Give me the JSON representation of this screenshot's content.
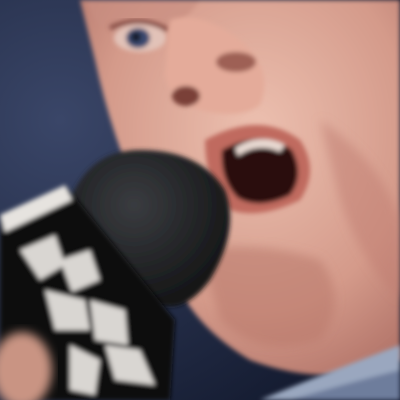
{
  "image": {
    "subject": "close-up-face-speaking-into-microphone",
    "colors": {
      "background": "#1b2440",
      "skin": "#d9a393",
      "skin_shadow": "#b8766a",
      "mouth": "#2a0d0c",
      "lips": "#c06a5e",
      "microphone": "#1c1d1f",
      "mic_flag": "#0e0e10",
      "mic_flag_marks": "#d9d6d2",
      "shirt": "#9aa7bf"
    }
  }
}
